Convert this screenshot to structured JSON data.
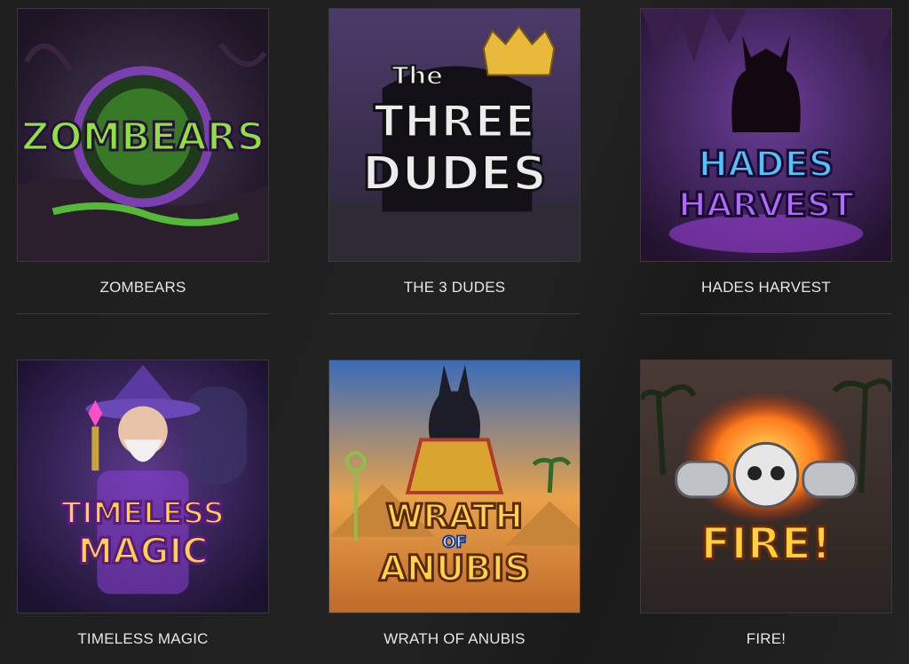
{
  "games": [
    {
      "title": "ZOMBEARS",
      "logo_lines": [
        "ZOMBEARS"
      ]
    },
    {
      "title": "THE 3 DUDES",
      "logo_lines": [
        "The",
        "THREE",
        "DUDES"
      ]
    },
    {
      "title": "HADES HARVEST",
      "logo_lines": [
        "HADES",
        "HARVEST"
      ]
    },
    {
      "title": "TIMELESS MAGIC",
      "logo_lines": [
        "TIMELESS",
        "MAGIC"
      ]
    },
    {
      "title": "WRATH OF ANUBIS",
      "logo_lines": [
        "WRATH",
        "OF",
        "ANUBIS"
      ]
    },
    {
      "title": "FIRE!",
      "logo_lines": [
        "FIRE!"
      ]
    }
  ]
}
